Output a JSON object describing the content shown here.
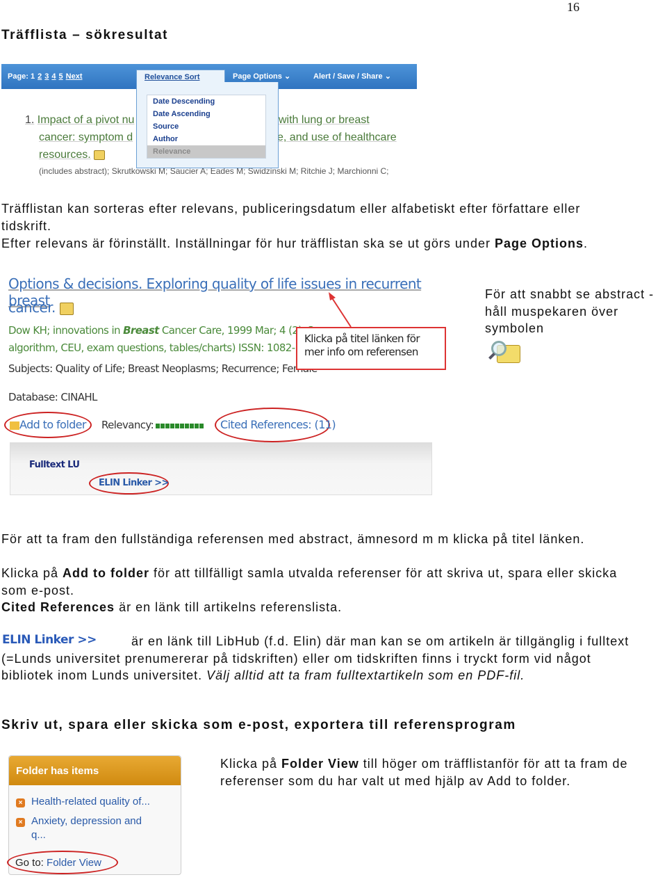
{
  "page_number": "16",
  "heading1": "Träfflista – sökresultat",
  "shot1": {
    "page_label": "Page: 1",
    "pages": [
      "2",
      "3",
      "4",
      "5"
    ],
    "next": "Next",
    "relevance_sort": "Relevance Sort",
    "page_options": "Page Options ⌄",
    "alert_save_share": "Alert / Save / Share ⌄",
    "sort_options": [
      "Date Descending",
      "Date Ascending",
      "Source",
      "Author",
      "Relevance"
    ],
    "selected_sort": "Relevance",
    "result_number": "1.",
    "result_line1_a": "Impact of a pivot nu",
    "result_line1_b": "with lung or breast",
    "result_line2_a": "cancer: symptom d",
    "result_line2_b": "e, and use of healthcare",
    "result_line3": "resources.",
    "result_meta": "(includes abstract); Skrutkowski M; Saucier A; Eades M; Swidzinski M; Ritchie J; Marchionni C;"
  },
  "para1_line1": "Träfflistan kan sorteras efter relevans, publiceringsdatum eller alfabetiskt efter författare eller",
  "para1_line2": "tidskrift.",
  "para1_line3_a": "Efter relevans är förinställt. Inställningar för hur träfflistan ska se ut görs under ",
  "para1_line3_b": "Page Options",
  "para1_line3_c": ".",
  "shot2": {
    "title_line1": "Options & decisions. Exploring quality of life issues in recurrent breast",
    "title_line2": "cancer.",
    "meta1_a": "Dow KH; innovations in ",
    "meta1_b": "Breast",
    "meta1_c": " Cancer Care, 1999 Mar; 4 (2): 3",
    "meta2": "algorithm, CEU, exam questions, tables/charts) ISSN: 1082-134",
    "subjects": "Subjects: Quality of Life; Breast Neoplasms; Recurrence; Female",
    "database": "Database: CINAHL",
    "add_to_folder": "Add to folder",
    "relevancy_label": "Relevancy:",
    "relevancy_level": 10,
    "cited_references": "Cited References: (11)",
    "fulltext": "Fulltext LU",
    "elin_linker": "ELIN Linker >>",
    "callout": "Klicka på titel länken för mer info om referensen",
    "accent": "#dd3333"
  },
  "side_note": "För att snabbt se abstract - håll muspekaren över symbolen",
  "para2": "För att ta fram den fullständiga referensen med abstract, ämnesord m m klicka på titel länken.",
  "para3_a": "Klicka på ",
  "para3_b": "Add to folder",
  "para3_c": " för att tillfälligt samla utvalda referenser för att skriva ut, spara eller skicka",
  "para3_line2": "som e-post.",
  "para4_a": "Cited References",
  "para4_b": " är en länk till artikelns referenslista.",
  "elin_logo": "ELIN Linker >>",
  "para5_line1": "är en länk till LibHub (f.d. Elin) där man kan se om artikeln är tillgänglig i fulltext",
  "para5_line2": "(=Lunds universitet prenumererar på tidskriften) eller om tidskriften finns i tryckt form vid något",
  "para5_line3_a": "bibliotek inom Lunds universitet. ",
  "para5_line3_b": "Välj alltid att ta fram fulltextartikeln som en PDF-fil.",
  "heading2": "Skriv ut, spara eller skicka som e-post, exportera till referensprogram",
  "shot3": {
    "header": "Folder has items",
    "items": [
      "Health-related quality of...",
      "Anxiety, depression and",
      "q..."
    ],
    "goto_label": "Go to: ",
    "folder_view": "Folder View"
  },
  "para6_a": "Klicka på ",
  "para6_b": "Folder View",
  "para6_c": " till höger om träfflistanför för att ta fram de",
  "para6_line2": "referenser som du har valt ut med hjälp av Add to folder."
}
